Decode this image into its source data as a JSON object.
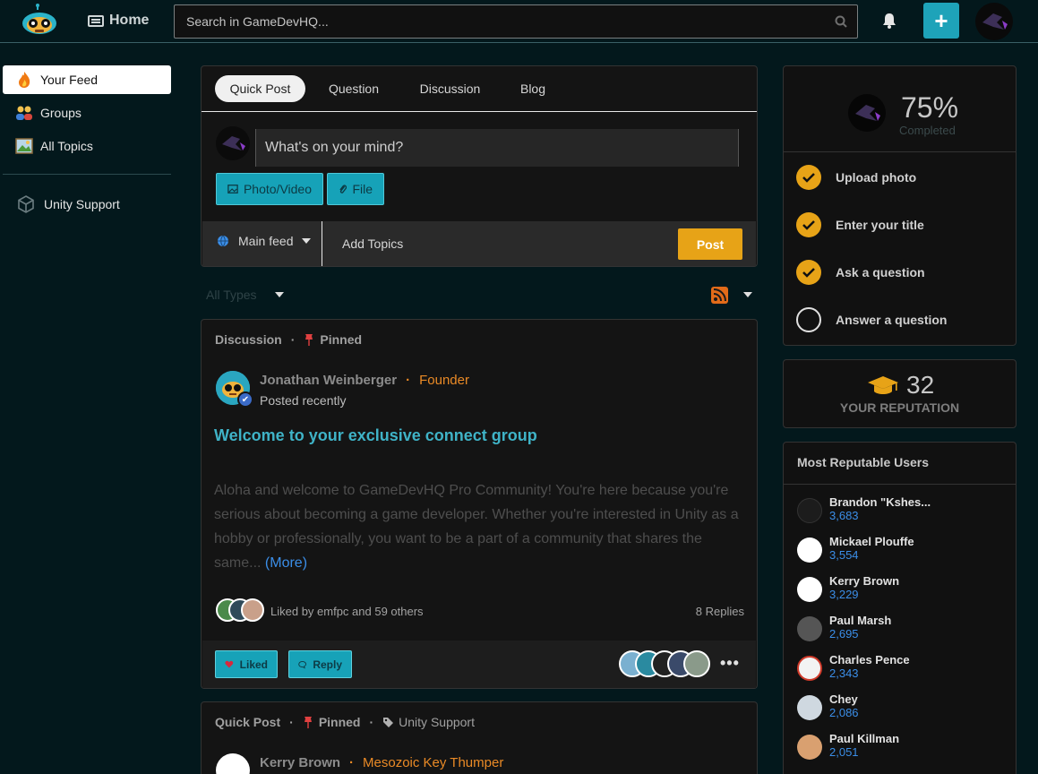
{
  "header": {
    "home_label": "Home",
    "search_placeholder": "Search in GameDevHQ...",
    "plus_label": "+"
  },
  "sidebar": {
    "items": [
      {
        "label": "Your Feed",
        "icon": "fire-icon"
      },
      {
        "label": "Groups",
        "icon": "people-icon"
      },
      {
        "label": "All Topics",
        "icon": "picture-icon"
      },
      {
        "label": "Unity Support",
        "icon": "unity-icon"
      }
    ]
  },
  "composer": {
    "tabs": [
      "Quick Post",
      "Question",
      "Discussion",
      "Blog"
    ],
    "active_tab": "Quick Post",
    "placeholder": "What's on your mind?",
    "photo_label": "Photo/Video",
    "file_label": "File",
    "feed_label": "Main feed",
    "add_topics_label": "Add Topics",
    "post_label": "Post"
  },
  "filter": {
    "types_label": "All Types"
  },
  "posts": [
    {
      "type": "Discussion",
      "pinned_label": "Pinned",
      "author": "Jonathan Weinberger",
      "role": "Founder",
      "posted": "Posted recently",
      "title": "Welcome to your exclusive connect group",
      "body": "Aloha and welcome to GameDevHQ Pro Community! You're here because you're serious about becoming a game developer. Whether you're interested in Unity as a hobby or professionally, you want to be a part of a community that shares the same...",
      "more_label": "(More)",
      "liked_by": "Liked by emfpc and 59 others",
      "replies": "8 Replies",
      "liked_label": "Liked",
      "reply_label": "Reply"
    },
    {
      "type": "Quick Post",
      "pinned_label": "Pinned",
      "topic": "Unity Support",
      "author": "Kerry Brown",
      "role": "Mesozoic Key Thumper"
    }
  ],
  "progress": {
    "percent": "75%",
    "sub_label": "Completed",
    "tasks": [
      {
        "label": "Upload photo",
        "done": true
      },
      {
        "label": "Enter your title",
        "done": true
      },
      {
        "label": "Ask a question",
        "done": true
      },
      {
        "label": "Answer a question",
        "done": false
      }
    ]
  },
  "reputation": {
    "value": "32",
    "label": "YOUR REPUTATION"
  },
  "top_users": {
    "heading": "Most Reputable Users",
    "users": [
      {
        "name": "Brandon \"Kshes...",
        "score": "3,683"
      },
      {
        "name": "Mickael Plouffe",
        "score": "3,554"
      },
      {
        "name": "Kerry Brown",
        "score": "3,229"
      },
      {
        "name": "Paul Marsh",
        "score": "2,695"
      },
      {
        "name": "Charles Pence",
        "score": "2,343"
      },
      {
        "name": "Chey",
        "score": "2,086"
      },
      {
        "name": "Paul Killman",
        "score": "2,051"
      }
    ]
  },
  "colors": {
    "accent": "#1ea3b9",
    "post_button": "#e7a317",
    "role": "#ea8a26",
    "link": "#3b8ee8",
    "background": "#03181c"
  }
}
